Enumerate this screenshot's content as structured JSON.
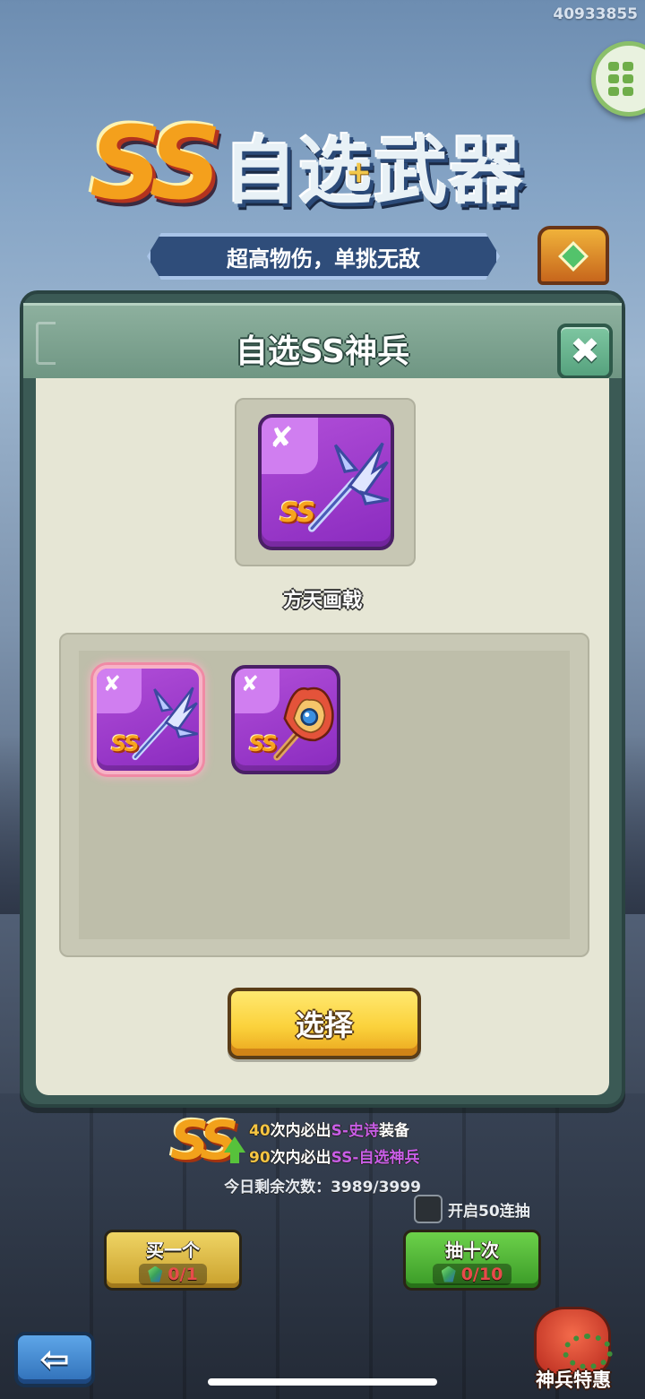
{
  "user_id": "40933855",
  "banner": {
    "ss": "SS",
    "title": "自选武器",
    "plus": "+",
    "subtitle": "超高物伤，单挑无敌"
  },
  "modal": {
    "title": "自选SS神兵",
    "close_label": "✖",
    "selected_weapon_name": "方天画戟",
    "rank_badge": "SS",
    "weapons": [
      {
        "id": "weapon-halberd",
        "selected": true
      },
      {
        "id": "weapon-fire-staff",
        "selected": false
      }
    ],
    "select_button_label": "选择"
  },
  "guarantee": {
    "logo": "SS",
    "line1_count": "40",
    "line1_mid": "次内必出",
    "line1_rarity": "S-史诗",
    "line1_tail": "装备",
    "line2_count": "90",
    "line2_mid": "次内必出",
    "line2_rarity": "SS-自选神兵"
  },
  "remaining_text": "今日剩余次数：3989/3999",
  "checkbox_label": "开启50连抽",
  "buttons": {
    "buy_one_label": "买一个",
    "buy_one_cost": "0/1",
    "draw_ten_label": "抽十次",
    "draw_ten_cost": "0/10",
    "back_icon": "⇦",
    "special_offer_label": "神兵特惠"
  },
  "colors": {
    "accent_yellow": "#fbd23c",
    "card_purple": "#8a2bbf",
    "draw_green": "#3a9a27",
    "cost_red": "#e84b4b"
  }
}
